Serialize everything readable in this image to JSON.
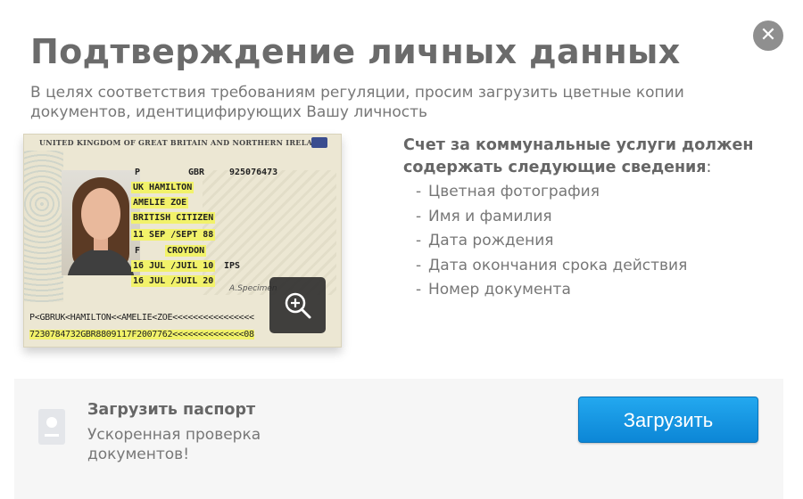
{
  "dialog": {
    "close_icon": "close-icon",
    "title": "Подтверждение личных данных",
    "subtitle": "В целях соответствия требованиям регуляции, просим загрузить цветные копии документов, идентицифирующих Вашу личность"
  },
  "passport": {
    "header": "UNITED KINGDOM OF GREAT BRITAIN AND NORTHERN IRELAND",
    "type": "P",
    "code": "GBR",
    "number": "925076473",
    "surname": "UK HAMILTON",
    "given_names": "AMELIE ZOE",
    "nationality": "BRITISH CITIZEN",
    "dob": "11 SEP /SEPT 88",
    "sex": "F",
    "place_of_birth": "CROYDON",
    "date_of_issue": "16 JUL /JUIL 10",
    "authority": "IPS",
    "date_of_expiry": "16 JUL /JUIL 20",
    "signature": "A.Specimen",
    "mrz_line1": "P<GBRUK<HAMILTON<<AMELIE<ZOE<<<<<<<<<<<<<<<<",
    "mrz_line2": "7230784732GBR8809117F2007762<<<<<<<<<<<<<<08",
    "zoom_icon": "zoom-in-icon"
  },
  "requirements": {
    "title": "Счет за коммунальные услуги должен содержать следующие сведения",
    "colon": ":",
    "items": [
      "Цветная фотография",
      "Имя и фамилия",
      "Дата рождения",
      "Дата окончания срока действия",
      "Номер документа"
    ]
  },
  "upload": {
    "icon": "document-icon",
    "title": "Загрузить паспорт",
    "subtitle": "Ускоренная проверка документов!",
    "button_label": "Загрузить"
  },
  "colors": {
    "accent": "#1a9ae6",
    "highlight": "#f2f26a",
    "title_gray": "#6b6b6b"
  }
}
